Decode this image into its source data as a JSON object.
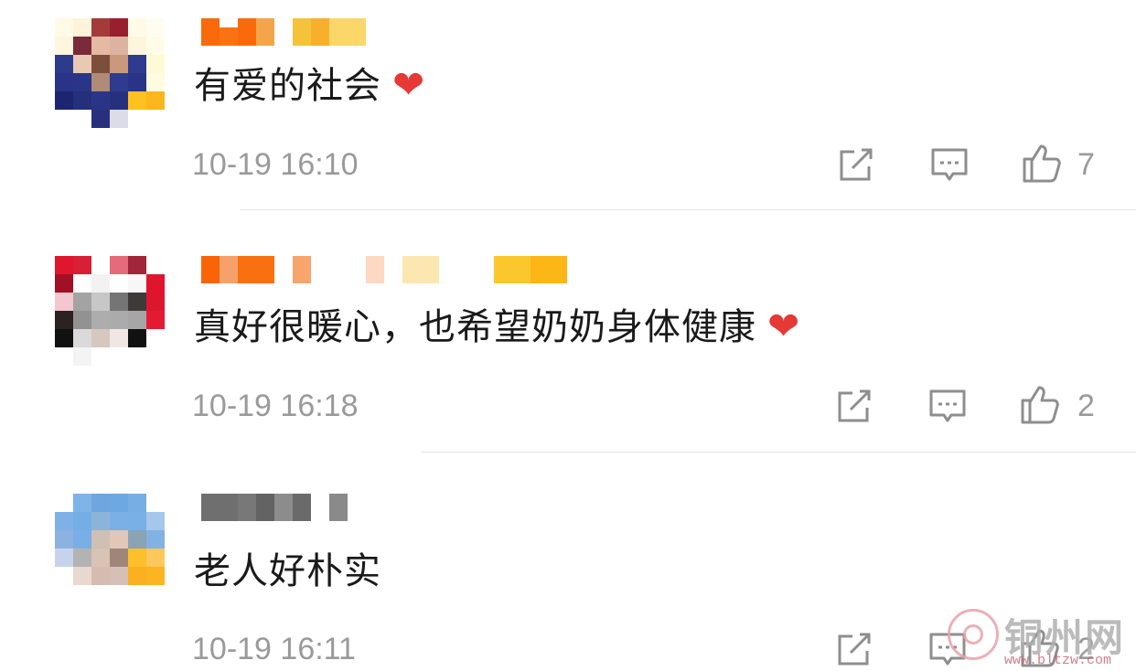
{
  "comments": [
    {
      "text": "有爱的社会",
      "heart": "❤",
      "time": "10-19 16:10",
      "likes": "7",
      "avatar_colors": [
        [
          "#fffbe6",
          "#fff3d9",
          "#a33b3b",
          "#9a1f2e",
          "#fffbe6",
          "#fffdf2"
        ],
        [
          "#fff6e0",
          "#7a2a38",
          "#e6b9a5",
          "#dcb3a0",
          "#fff4dc",
          "#fffde8"
        ],
        [
          "#2e3a8c",
          "#e9c9b4",
          "#7b4f3b",
          "#c9987d",
          "#2f3b8f",
          "#fffad6"
        ],
        [
          "#2a3486",
          "#2b3587",
          "#b08b77",
          "#2f3b8e",
          "#2a3486",
          "#fffbe0"
        ],
        [
          "#1e2570",
          "#25307d",
          "#2a3587",
          "#26307e",
          "#fdc21f",
          "#fbb71b"
        ],
        [
          "#ffffff",
          "#ffffff",
          "#28307d",
          "#dbdce8",
          "#ffffff",
          "#ffffff"
        ]
      ],
      "name_blocks": [
        "#f96a0b",
        "#f97314",
        "#f96a0b",
        "#f4a44a",
        "#f5c33a",
        "#f8b02c",
        "#fbd76a"
      ]
    },
    {
      "text": "真好很暖心，也希望奶奶身体健康",
      "heart": "❤",
      "time": "10-19 16:18",
      "likes": "2",
      "avatar_colors": [
        [
          "#e0162e",
          "#d81f35",
          "#ffffff",
          "#e56b7c",
          "#a1263b",
          "#ffffff"
        ],
        [
          "#a11024",
          "#ffffff",
          "#f2f2f2",
          "#ffffff",
          "#f7f7f7",
          "#e0152d"
        ],
        [
          "#f4c6cf",
          "#a3a3a3",
          "#c7c7c7",
          "#757575",
          "#3e3a3a",
          "#dd1630"
        ],
        [
          "#2c2222",
          "#929292",
          "#adadad",
          "#ababab",
          "#a6a6a6",
          "#e41a33"
        ],
        [
          "#111111",
          "#dadada",
          "#d6c7c0",
          "#f0e7e5",
          "#111111",
          "#ffffff"
        ],
        [
          "#ffffff",
          "#f4f4f4",
          "#ffffff",
          "#ffffff",
          "#ffffff",
          "#ffffff"
        ]
      ],
      "name_blocks": [
        "#f86407",
        "#f6a06a",
        "#f97010",
        "#f7a56c",
        "#fbd9c3",
        "#fde7b1",
        "#fbc72c",
        "#fcb716"
      ]
    },
    {
      "text": "老人好朴实",
      "heart": "",
      "time": "10-19 16:11",
      "likes": "2",
      "avatar_colors": [
        [
          "#ffffff",
          "#7fb4e8",
          "#6fa6e0",
          "#6ea8e2",
          "#77aee4",
          "#ffffff"
        ],
        [
          "#7eb2e6",
          "#74aee4",
          "#8bb5d8",
          "#7ab0e6",
          "#79b0e6",
          "#a4c7ec"
        ],
        [
          "#8bb2e0",
          "#7aaee6",
          "#cfbfb4",
          "#e0c7b8",
          "#8aa3b5",
          "#82b1e3"
        ],
        [
          "#c7d3ec",
          "#b3b3b3",
          "#d8c3b4",
          "#a08679",
          "#fdc02c",
          "#ffc85c"
        ],
        [
          "#ffffff",
          "#e8d8d0",
          "#d5bcae",
          "#d6c0b6",
          "#fbb021",
          "#fcb41f"
        ],
        [
          "#ffffff",
          "#ffffff",
          "#ffffff",
          "#ffffff",
          "#ffffff",
          "#ffffff"
        ]
      ],
      "name_blocks": [
        "#6f6f6f",
        "#787878",
        "#636363",
        "#8c8c8c",
        "#6a6a6a",
        "#8a8a8a"
      ]
    }
  ],
  "icons": {
    "share": "share-icon",
    "reply": "comment-icon",
    "like": "thumbs-up-icon"
  },
  "watermark": {
    "name": "铜州网",
    "url": "www.bltzw.com"
  }
}
